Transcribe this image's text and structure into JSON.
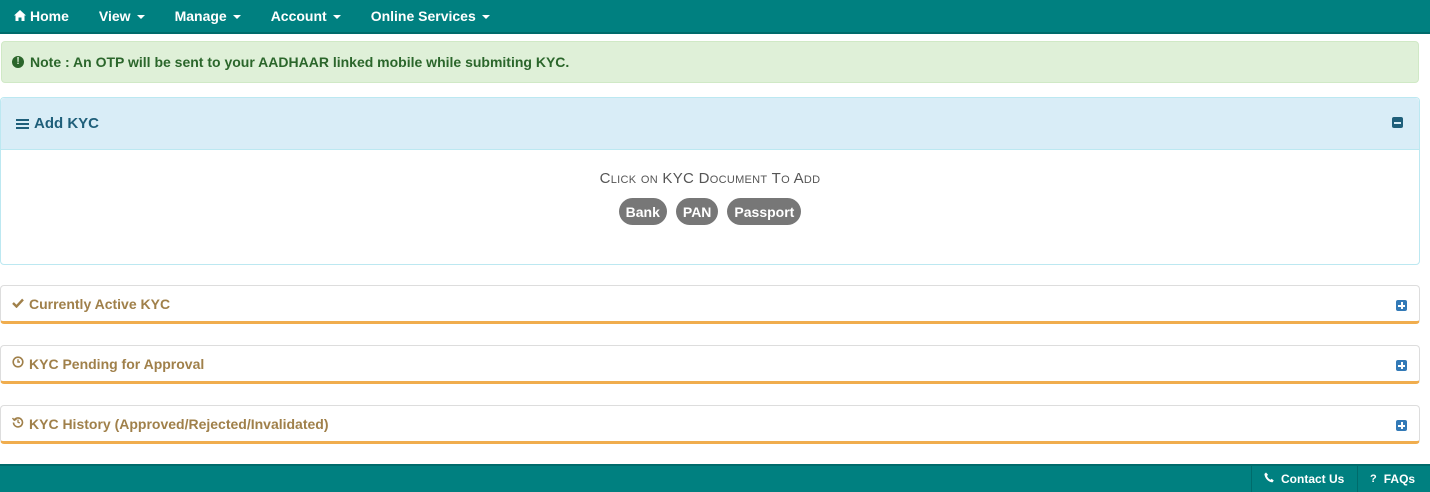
{
  "nav": {
    "home": "Home",
    "items": [
      "View",
      "Manage",
      "Account",
      "Online Services"
    ]
  },
  "note": "Note : An OTP will be sent to your AADHAAR linked mobile while submiting KYC.",
  "add_kyc": {
    "title": "Add KYC",
    "hint": "Click on KYC Document To Add",
    "documents": [
      "Bank",
      "PAN",
      "Passport"
    ]
  },
  "panels": {
    "active": "Currently Active KYC",
    "pending": "KYC Pending for Approval",
    "history": "KYC History (Approved/Rejected/Invalidated)"
  },
  "footer": {
    "contact": "Contact Us",
    "faqs": "FAQs"
  },
  "icons": {
    "home": "home-icon",
    "note": "info-circle-icon",
    "add_kyc": "bars-icon",
    "collapse": "minus-square-icon",
    "expand": "plus-square-icon",
    "active": "check-icon",
    "pending": "clock-icon",
    "history": "history-icon",
    "contact": "phone-icon",
    "faqs": "question-icon"
  },
  "colors": {
    "navbar": "#008080",
    "alert_bg": "#dff0d8",
    "alert_text": "#2b662b",
    "info_panel_bg": "#d9edf7",
    "panel_accent": "#f0ad4e",
    "badge_bg": "#777777"
  }
}
